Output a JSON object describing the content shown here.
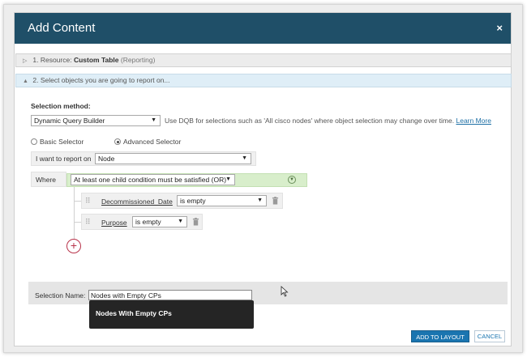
{
  "dialog": {
    "title": "Add Content",
    "close_symbol": "×"
  },
  "sections": {
    "resource": {
      "prefix": "1. Resource:",
      "name": "Custom Table",
      "suffix": "(Reporting)"
    },
    "select_objects": {
      "label": "2. Select objects you are going to report on..."
    }
  },
  "selection_method": {
    "label": "Selection method:",
    "value": "Dynamic Query Builder",
    "hint": "Use DQB for selections such as 'All cisco nodes' where object selection may change over time.",
    "learn_more": "Learn More"
  },
  "selector_mode": {
    "basic": "Basic Selector",
    "advanced": "Advanced Selector",
    "selected": "advanced"
  },
  "report_on": {
    "label": "I want to report on",
    "value": "Node"
  },
  "where": {
    "label": "Where",
    "condition": "At least one child condition must be satisfied (OR)",
    "conditions": [
      {
        "field": "Decommissioned_Date",
        "operator": "is empty"
      },
      {
        "field": "Purpose",
        "operator": "is empty"
      }
    ]
  },
  "selection_name": {
    "label": "Selection Name:",
    "value": "Nodes with Empty CPs",
    "suggestion": "Nodes With Empty CPs"
  },
  "buttons": {
    "add_to_layout": "ADD TO LAYOUT",
    "cancel": "CANCEL"
  },
  "colors": {
    "title_bar": "#1f4f68",
    "primary_button": "#1a75b0",
    "where_bar": "#d8eecb",
    "add_condition": "#b8334a"
  },
  "icons": {
    "add_condition": "plus-circle-icon",
    "delete": "trash-icon",
    "collapse": "chevron-down-circle-icon"
  }
}
